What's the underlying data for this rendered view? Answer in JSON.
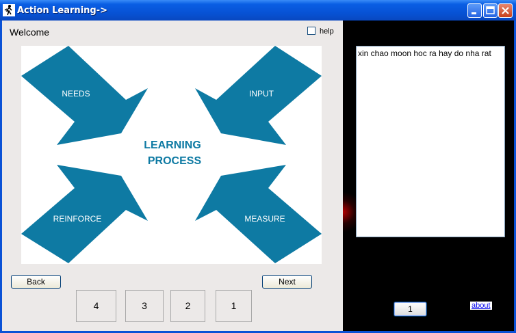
{
  "window": {
    "title": "Action Learning->",
    "icon": "runner-icon",
    "controls": [
      "minimize",
      "maximize",
      "close"
    ]
  },
  "left": {
    "welcome": "Welcome",
    "help_label": "help",
    "help_checked": false,
    "diagram": {
      "center_line1": "LEARNING",
      "center_line2": "PROCESS",
      "arrows": [
        "NEEDS",
        "INPUT",
        "REINFORCE",
        "MEASURE"
      ],
      "color": "#0e7aa3"
    },
    "back_label": "Back",
    "next_label": "Next",
    "pages": [
      "4",
      "3",
      "2",
      "1"
    ]
  },
  "right": {
    "text": "xin chao moon hoc ra hay do nha rat",
    "page_button": "1",
    "about_link": "about"
  }
}
